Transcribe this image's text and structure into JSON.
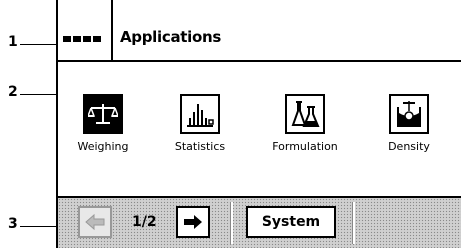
{
  "title_bar": {
    "title": "Applications",
    "menu_icon": "menu-dots-icon"
  },
  "applications": [
    {
      "label": "Weighing",
      "icon": "balance-scale-icon",
      "selected": true
    },
    {
      "label": "Statistics",
      "icon": "bar-chart-icon",
      "selected": false
    },
    {
      "label": "Formulation",
      "icon": "flasks-icon",
      "selected": false
    },
    {
      "label": "Density",
      "icon": "beaker-sinker-icon",
      "selected": false
    }
  ],
  "nav": {
    "prev_icon": "arrow-left-icon",
    "page_indicator": "1/2",
    "next_icon": "arrow-right-icon",
    "system_label": "System"
  },
  "callouts": {
    "c1": "1",
    "c2": "2",
    "c3": "3"
  }
}
